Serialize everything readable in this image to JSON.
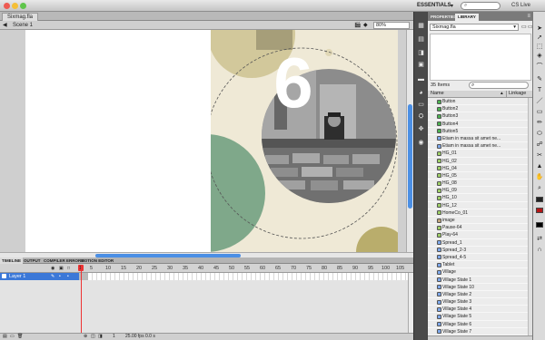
{
  "app": {
    "workspace": "ESSENTIALS",
    "workspace_arrow": "▾",
    "search_placeholder": "",
    "cslive": "CS Live"
  },
  "document": {
    "tab": "Sixmag.fla",
    "scene": "Scene 1",
    "zoom": "80%",
    "stage_number": "6",
    "colors": {
      "stage_bg": "#efe9d6",
      "green": "#7fa88a",
      "olive": "#b9ad6c"
    }
  },
  "timeline": {
    "tabs": [
      "TIMELINE",
      "OUTPUT",
      "COMPILER ERRORS",
      "MOTION EDITOR"
    ],
    "frame_labels": [
      "1",
      "5",
      "10",
      "15",
      "20",
      "25",
      "30",
      "35",
      "40",
      "45",
      "50",
      "55",
      "60",
      "65",
      "70",
      "75",
      "80",
      "85",
      "90",
      "95",
      "100",
      "105"
    ],
    "layer": "Layer 1",
    "footer": {
      "frame": "1",
      "fps": "25.00 fps",
      "time": "0.0 s"
    }
  },
  "library": {
    "tabs": [
      "PROPERTIES",
      "LIBRARY"
    ],
    "document": "Sixmag.fla",
    "count": "35 Items",
    "columns": {
      "name": "Name",
      "linkage": "Linkage"
    },
    "items": [
      {
        "name": "Button",
        "icon": "btn"
      },
      {
        "name": "Button2",
        "icon": "btn"
      },
      {
        "name": "Button3",
        "icon": "btn"
      },
      {
        "name": "Button4",
        "icon": "btn"
      },
      {
        "name": "Button5",
        "icon": "btn"
      },
      {
        "name": "Etiam in massa sit amet ne...",
        "icon": "mc"
      },
      {
        "name": "Etiam in massa sit amet ne...",
        "icon": "mc"
      },
      {
        "name": "HG_01",
        "icon": "gr"
      },
      {
        "name": "HG_02",
        "icon": "gr"
      },
      {
        "name": "HG_04",
        "icon": "gr"
      },
      {
        "name": "HG_05",
        "icon": "gr"
      },
      {
        "name": "HG_08",
        "icon": "gr"
      },
      {
        "name": "HG_09",
        "icon": "gr"
      },
      {
        "name": "HG_10",
        "icon": "gr"
      },
      {
        "name": "HG_12",
        "icon": "gr"
      },
      {
        "name": "HomeCo_01",
        "icon": "gr"
      },
      {
        "name": "image",
        "icon": "bmp"
      },
      {
        "name": "Pause-64",
        "icon": "gr"
      },
      {
        "name": "Play-64",
        "icon": "gr"
      },
      {
        "name": "Spread_1",
        "icon": "mc"
      },
      {
        "name": "Spread_2-3",
        "icon": "mc"
      },
      {
        "name": "Spread_4-5",
        "icon": "mc"
      },
      {
        "name": "Tablet",
        "icon": "mc"
      },
      {
        "name": "Village",
        "icon": "mc"
      },
      {
        "name": "Village State 1",
        "icon": "mc"
      },
      {
        "name": "Village State 10",
        "icon": "mc"
      },
      {
        "name": "Village State 2",
        "icon": "mc"
      },
      {
        "name": "Village State 3",
        "icon": "mc"
      },
      {
        "name": "Village State 4",
        "icon": "mc"
      },
      {
        "name": "Village State 5",
        "icon": "mc"
      },
      {
        "name": "Village State 6",
        "icon": "mc"
      },
      {
        "name": "Village State 7",
        "icon": "mc"
      }
    ]
  },
  "icons": {
    "back": "◀",
    "pin": "▭",
    "menu": "≡",
    "search": "⌕",
    "dock": [
      "▦",
      "▤",
      "◨",
      "▣",
      "▬",
      "◕",
      "▭",
      "⛭",
      "✥",
      "◉"
    ],
    "tools": [
      "➤",
      "➚",
      "⬚",
      "✎",
      "T",
      "▭",
      "／",
      "✏",
      "⬭",
      "◈",
      "⌒",
      "✂",
      "☍",
      "✋",
      "⌕",
      "▲"
    ]
  }
}
